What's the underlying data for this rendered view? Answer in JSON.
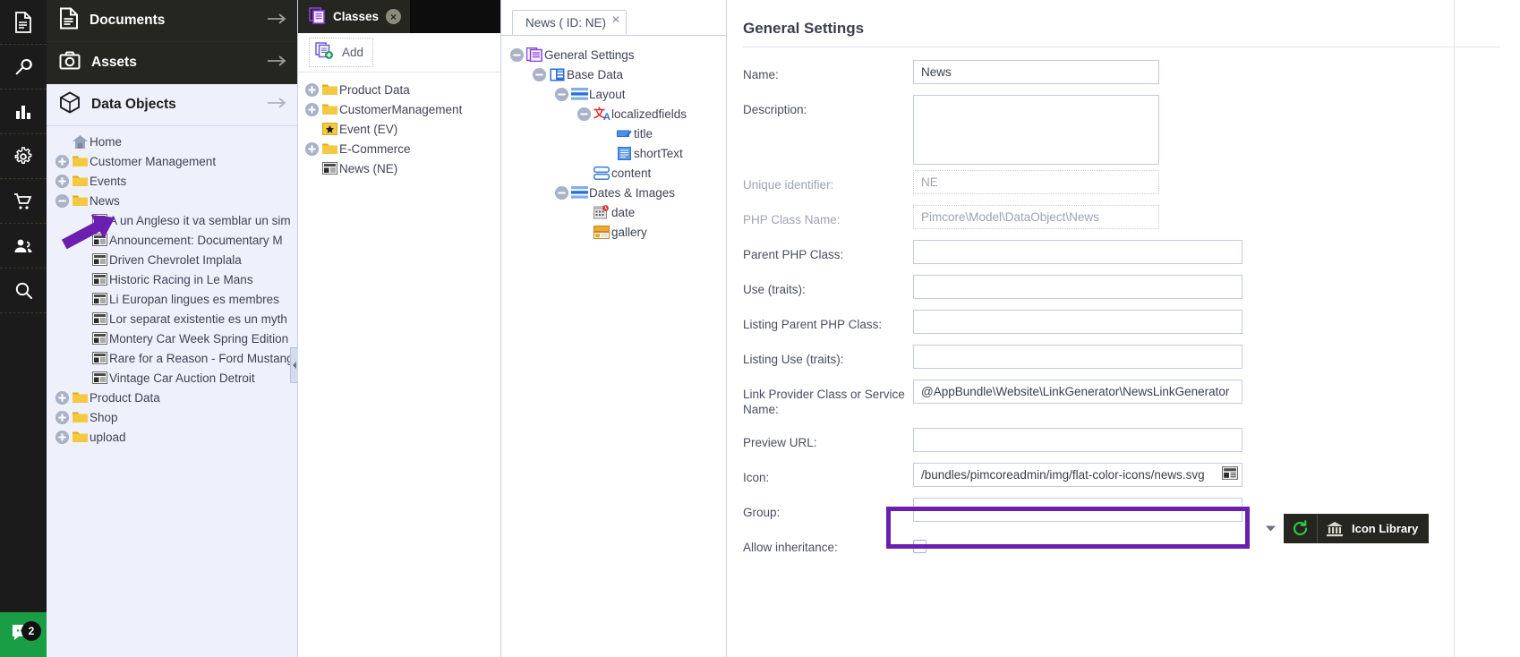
{
  "rail": {
    "items": [
      {
        "name": "documents-icon",
        "label": "Documents"
      },
      {
        "name": "tools-icon",
        "label": "Tools"
      },
      {
        "name": "reports-icon",
        "label": "Reports"
      },
      {
        "name": "settings-icon",
        "label": "Settings"
      },
      {
        "name": "ecommerce-icon",
        "label": "E-Commerce"
      },
      {
        "name": "customers-icon",
        "label": "Customers"
      },
      {
        "name": "search-icon",
        "label": "Search"
      }
    ],
    "chat_badge": "2"
  },
  "navpanel": {
    "sections": [
      {
        "title": "Documents",
        "icon": "document-icon",
        "state": "dark"
      },
      {
        "title": "Assets",
        "icon": "camera-icon",
        "state": "dark"
      },
      {
        "title": "Data Objects",
        "icon": "cube-icon",
        "state": "light"
      }
    ],
    "tree": [
      {
        "label": "Home",
        "icon": "home-icon",
        "indent": 0,
        "expander": "none"
      },
      {
        "label": "Customer Management",
        "icon": "folder-icon",
        "indent": 0,
        "expander": "plus"
      },
      {
        "label": "Events",
        "icon": "folder-icon",
        "indent": 0,
        "expander": "plus"
      },
      {
        "label": "News",
        "icon": "folder-icon",
        "indent": 0,
        "expander": "minus"
      },
      {
        "label": "A un Angleso it va semblar un sim",
        "icon": "news-icon",
        "indent": 1,
        "expander": "none"
      },
      {
        "label": "Announcement: Documentary M",
        "icon": "news-icon",
        "indent": 1,
        "expander": "none"
      },
      {
        "label": "Driven Chevrolet Implala",
        "icon": "news-icon",
        "indent": 1,
        "expander": "none"
      },
      {
        "label": "Historic Racing in Le Mans",
        "icon": "news-icon",
        "indent": 1,
        "expander": "none"
      },
      {
        "label": "Li Europan lingues es membres",
        "icon": "news-icon",
        "indent": 1,
        "expander": "none"
      },
      {
        "label": "Lor separat existentie es un myth",
        "icon": "news-icon",
        "indent": 1,
        "expander": "none"
      },
      {
        "label": "Montery Car Week Spring Edition",
        "icon": "news-icon",
        "indent": 1,
        "expander": "none"
      },
      {
        "label": "Rare for a Reason - Ford Mustang",
        "icon": "news-icon",
        "indent": 1,
        "expander": "none"
      },
      {
        "label": "Vintage Car Auction Detroit",
        "icon": "news-icon",
        "indent": 1,
        "expander": "none"
      },
      {
        "label": "Product Data",
        "icon": "folder-icon",
        "indent": 0,
        "expander": "plus"
      },
      {
        "label": "Shop",
        "icon": "folder-icon",
        "indent": 0,
        "expander": "plus"
      },
      {
        "label": "upload",
        "icon": "folder-icon",
        "indent": 0,
        "expander": "plus"
      }
    ]
  },
  "classpanel": {
    "tab_label": "Classes",
    "tab_icon": "classes-icon",
    "close_label": "×",
    "add_label": "Add",
    "add_icon": "add-class-icon",
    "tree": [
      {
        "label": "Product Data",
        "icon": "folder-icon",
        "expander": "plus"
      },
      {
        "label": "CustomerManagement",
        "icon": "folder-icon",
        "expander": "plus"
      },
      {
        "label": "Event (EV)",
        "icon": "star-icon",
        "expander": "none"
      },
      {
        "label": "E-Commerce",
        "icon": "folder-icon",
        "expander": "plus"
      },
      {
        "label": "News (NE)",
        "icon": "news-icon",
        "expander": "none"
      }
    ]
  },
  "defpanel": {
    "tab_label": "News ( ID: NE)",
    "tab_close": "✕",
    "tree": [
      {
        "label": "General Settings",
        "icon": "general-settings-icon",
        "indent": 0,
        "expander": "minus"
      },
      {
        "label": "Base Data",
        "icon": "base-data-icon",
        "indent": 1,
        "expander": "minus"
      },
      {
        "label": "Layout",
        "icon": "layout-icon",
        "indent": 2,
        "expander": "minus"
      },
      {
        "label": "localizedfields",
        "icon": "localizedfields-icon",
        "indent": 3,
        "expander": "minus"
      },
      {
        "label": "title",
        "icon": "input-field-icon",
        "indent": 4,
        "expander": "none"
      },
      {
        "label": "shortText",
        "icon": "textarea-icon",
        "indent": 4,
        "expander": "none"
      },
      {
        "label": "content",
        "icon": "wysiwyg-icon",
        "indent": 3,
        "expander": "none"
      },
      {
        "label": "Dates & Images",
        "icon": "layout-icon",
        "indent": 2,
        "expander": "minus"
      },
      {
        "label": "date",
        "icon": "date-icon",
        "indent": 3,
        "expander": "none"
      },
      {
        "label": "gallery",
        "icon": "gallery-icon",
        "indent": 3,
        "expander": "none"
      }
    ]
  },
  "form": {
    "title": "General Settings",
    "fields": [
      {
        "label": "Name:",
        "value": "News",
        "type": "text",
        "disabled": false,
        "width": "w275"
      },
      {
        "label": "Description:",
        "value": "",
        "type": "textarea",
        "disabled": false,
        "width": "w275"
      },
      {
        "label": "Unique identifier:",
        "value": "NE",
        "type": "text",
        "disabled": true,
        "width": "w275"
      },
      {
        "label": "PHP Class Name:",
        "value": "Pimcore\\Model\\DataObject\\News",
        "type": "text",
        "disabled": true,
        "width": "w275"
      },
      {
        "label": "Parent PHP Class:",
        "value": "",
        "type": "text",
        "disabled": false,
        "width": "w368"
      },
      {
        "label": "Use (traits):",
        "value": "",
        "type": "text",
        "disabled": false,
        "width": "w368"
      },
      {
        "label": "Listing Parent PHP Class:",
        "value": "",
        "type": "text",
        "disabled": false,
        "width": "w368"
      },
      {
        "label": "Listing Use (traits):",
        "value": "",
        "type": "text",
        "disabled": false,
        "width": "w368"
      },
      {
        "label": "Link Provider Class or Service Name:",
        "value": "@AppBundle\\Website\\LinkGenerator\\NewsLinkGenerator",
        "type": "text",
        "disabled": false,
        "width": "w368"
      },
      {
        "label": "Preview URL:",
        "value": "",
        "type": "text",
        "disabled": false,
        "width": "w368"
      },
      {
        "label": "Icon:",
        "value": "/bundles/pimcoreadmin/img/flat-color-icons/news.svg",
        "type": "icon",
        "disabled": false,
        "width": "w368"
      },
      {
        "label": "Group:",
        "value": "",
        "type": "text",
        "disabled": false,
        "width": "w368"
      },
      {
        "label": "Allow inheritance:",
        "value": "",
        "type": "checkbox",
        "disabled": false,
        "width": ""
      }
    ],
    "icon_library_label": "Icon Library",
    "refresh_icon": "refresh-icon",
    "library_icon": "bank-icon",
    "combo_arrow_icon": "chevron-down-icon"
  },
  "colors": {
    "accent_purple": "#6a1fb0",
    "dark_chrome": "#262620",
    "panel_bg": "#eef1fb",
    "green": "#1a9e45"
  }
}
